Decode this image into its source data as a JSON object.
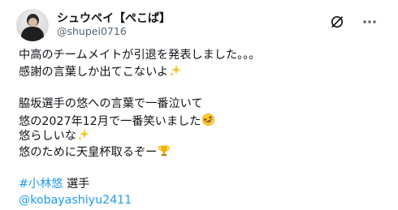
{
  "user": {
    "display_name": "シュウペイ【ぺこぱ】",
    "handle": "@shupei0716"
  },
  "post": {
    "line1": "中高のチームメイトが引退を発表しました。。。",
    "line2": "感謝の言葉しか出てこないよ",
    "line3": "脇坂選手の悠への言葉で一番泣いて",
    "line4": "悠の2027年12月で一番笑いました",
    "line5": "悠らしいな",
    "line6": "悠のために天皇杯取るぞー",
    "hashtag": "#小林悠",
    "after_hashtag": " 選手",
    "mention": "@kobayashiyu2411"
  },
  "icons": {
    "grok": "grok-icon",
    "more": "more-options-icon",
    "sparkles": "sparkles-emoji",
    "laughing": "rolling-laughing-emoji",
    "trophy": "trophy-emoji"
  },
  "colors": {
    "text": "#0f1419",
    "secondary": "#536471",
    "link": "#1d9bf0"
  }
}
